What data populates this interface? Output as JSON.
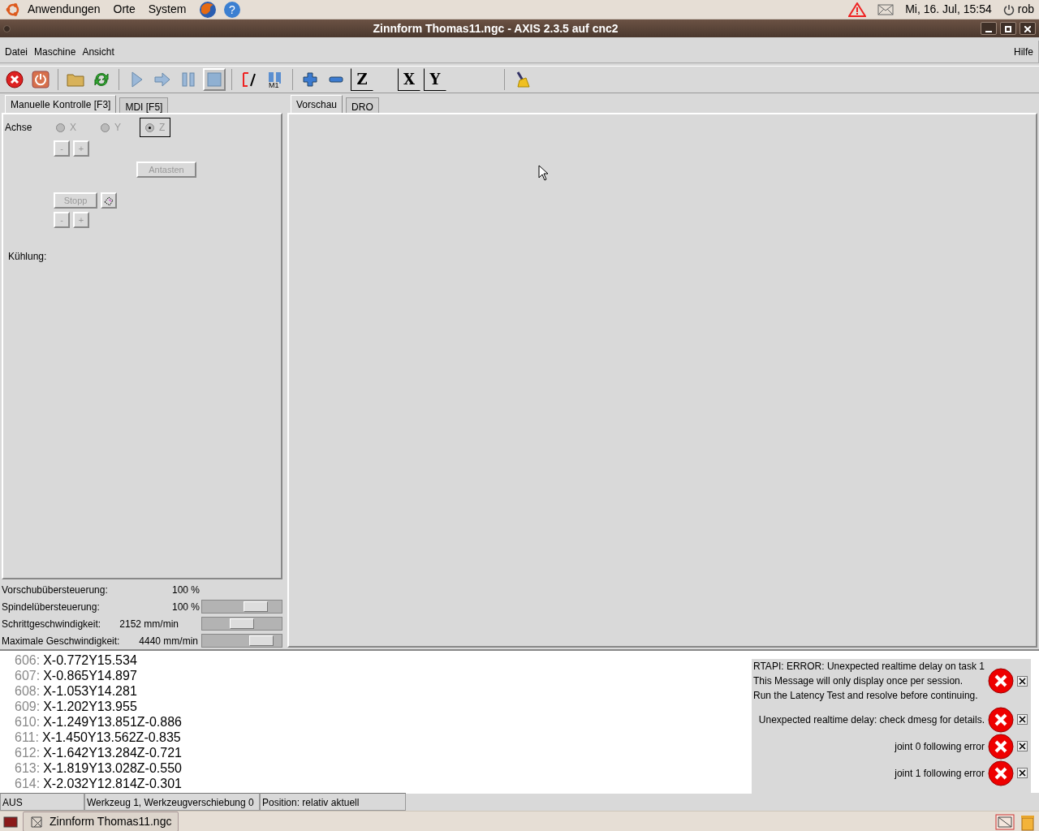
{
  "top_panel": {
    "menus": [
      "Anwendungen",
      "Orte",
      "System"
    ],
    "help_glyph": "?",
    "clock": "Mi, 16. Jul, 15:54",
    "user": "rob"
  },
  "window": {
    "title": "Zinnform Thomas11.ngc - AXIS 2.3.5 auf  cnc2"
  },
  "menu": [
    "Datei",
    "Maschine",
    "Ansicht"
  ],
  "help_menu": "Hilfe",
  "toolbar": [
    {
      "kind": "estop",
      "pressed": false
    },
    {
      "kind": "power",
      "pressed": false
    },
    {
      "kind": "sep"
    },
    {
      "kind": "open",
      "pressed": false
    },
    {
      "kind": "reload",
      "pressed": false
    },
    {
      "kind": "sep"
    },
    {
      "kind": "run",
      "pressed": false
    },
    {
      "kind": "step",
      "pressed": false
    },
    {
      "kind": "pause",
      "pressed": false
    },
    {
      "kind": "stop",
      "pressed": true
    },
    {
      "kind": "sep"
    },
    {
      "kind": "blockdelete",
      "pressed": false
    },
    {
      "kind": "m1",
      "pressed": false,
      "label": "M1"
    },
    {
      "kind": "sep"
    },
    {
      "kind": "zoomin",
      "pressed": false
    },
    {
      "kind": "zoomout",
      "pressed": false
    },
    {
      "kind": "view",
      "pressed": false,
      "label": "Z"
    },
    {
      "kind": "gap"
    },
    {
      "kind": "view",
      "pressed": false,
      "label": "X"
    },
    {
      "kind": "view",
      "pressed": false,
      "label": "Y"
    },
    {
      "kind": "wide"
    },
    {
      "kind": "sep"
    },
    {
      "kind": "clear",
      "pressed": false
    }
  ],
  "left_tabs": [
    {
      "label": "Manuelle Kontrolle [F3]",
      "selected": true
    },
    {
      "label": "MDI [F5]",
      "selected": false
    }
  ],
  "manual": {
    "axis_label": "Achse",
    "axes": [
      {
        "label": "X",
        "selected": false
      },
      {
        "label": "Y",
        "selected": false
      },
      {
        "label": "Z",
        "selected": true
      }
    ],
    "minus": "-",
    "plus": "+",
    "probe": "Antasten",
    "spindle_stop": "Stopp",
    "spindle_minus": "-",
    "spindle_plus": "+",
    "coolant_label": "Kühlung:"
  },
  "overrides": [
    {
      "label": "Vorschubübersteuerung:",
      "reading": "100 %"
    },
    {
      "label": "Spindelübersteuerung:",
      "reading": "100 %",
      "level": 0.75
    },
    {
      "label": "Schrittgeschwindigkeit:",
      "reading": "2152 mm/min",
      "level": 0.5
    },
    {
      "label": "Maximale Geschwindigkeit:",
      "reading": "4440 mm/min",
      "level": 0.85
    }
  ],
  "right_tabs": [
    {
      "label": "Vorschau",
      "selected": true
    },
    {
      "label": "DRO",
      "selected": false
    }
  ],
  "gcode": [
    {
      "line": "606:",
      "code": "X-0.772Y15.534"
    },
    {
      "line": "607:",
      "code": "X-0.865Y14.897"
    },
    {
      "line": "608:",
      "code": "X-1.053Y14.281"
    },
    {
      "line": "609:",
      "code": "X-1.202Y13.955"
    },
    {
      "line": "610:",
      "code": "X-1.249Y13.851Z-0.886"
    },
    {
      "line": "611:",
      "code": "X-1.450Y13.562Z-0.835"
    },
    {
      "line": "612:",
      "code": "X-1.642Y13.284Z-0.721"
    },
    {
      "line": "613:",
      "code": "X-1.819Y13.028Z-0.550"
    },
    {
      "line": "614:",
      "code": "X-2.032Y12.814Z-0.301"
    }
  ],
  "notifications": [
    {
      "lines": [
        "RTAPI: ERROR: Unexpected realtime delay on task 1",
        "This Message will only display once per session.",
        "Run the Latency Test and resolve before continuing."
      ]
    },
    {
      "lines": [
        "Unexpected realtime delay: check dmesg for details."
      ]
    },
    {
      "lines": [
        "joint 0 following error"
      ]
    },
    {
      "lines": [
        "joint 1 following error"
      ]
    }
  ],
  "status_bar": [
    "AUS",
    "Werkzeug 1, Werkzeugverschiebung 0",
    "Position: relativ aktuell"
  ],
  "taskbar": {
    "task": "Zinnform Thomas11.ngc"
  }
}
